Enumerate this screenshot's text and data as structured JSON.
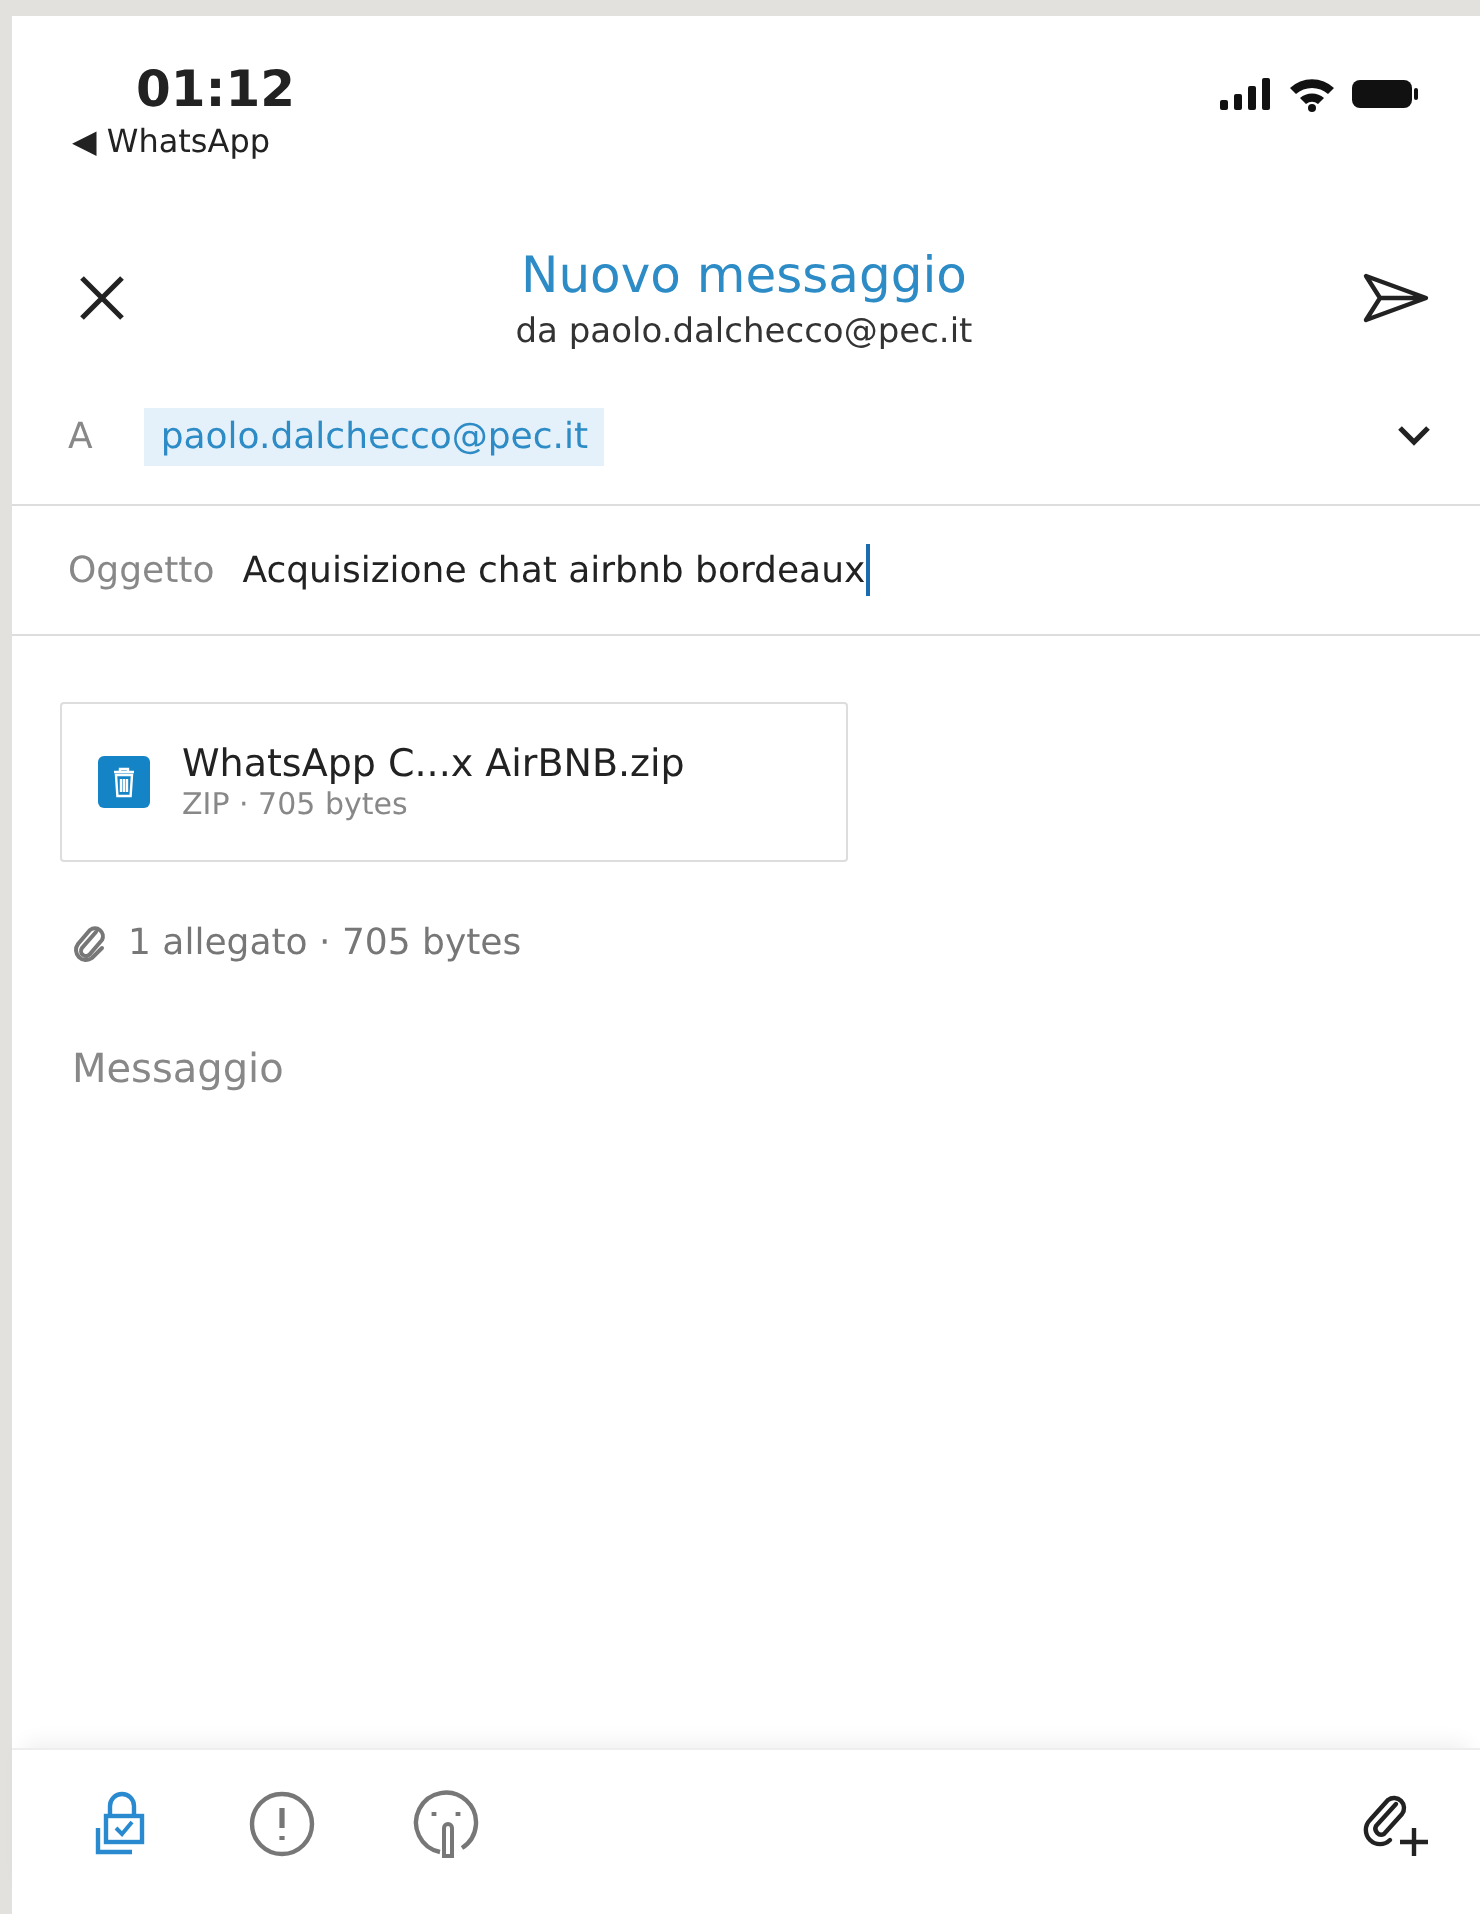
{
  "status_bar": {
    "time": "01:12",
    "back_app": "◀ WhatsApp"
  },
  "header": {
    "title": "Nuovo messaggio",
    "subtitle": "da paolo.dalchecco@pec.it"
  },
  "to": {
    "label": "A",
    "recipients": [
      {
        "text": "paolo.dalchecco@pec.it",
        "selected": true
      }
    ]
  },
  "subject": {
    "label": "Oggetto",
    "value": "Acquisizione chat airbnb bordeaux"
  },
  "attachments": [
    {
      "name": "WhatsApp C...x AirBNB.zip",
      "meta": "ZIP · 705 bytes"
    }
  ],
  "attachment_summary": "1 allegato · 705 bytes",
  "message": {
    "placeholder": "Messaggio"
  },
  "toolbar": [
    {
      "kind": "lock",
      "on": true
    },
    {
      "kind": "alert",
      "on": false
    },
    {
      "kind": "hush",
      "on": false
    }
  ]
}
